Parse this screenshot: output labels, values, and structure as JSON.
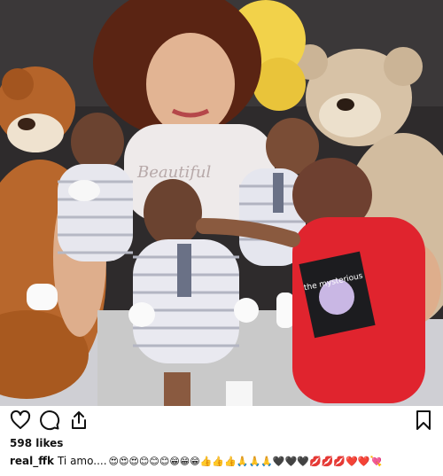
{
  "post": {
    "likes_text": "598 likes",
    "caption": {
      "username": "real_ffk",
      "text": "Ti amo....",
      "emojis": "😍😍😍😊😊😊😁😁😁👍👍👍🙏🙏🙏🖤🖤🖤💋💋💋❤️❤️💘"
    }
  },
  "icons": {
    "like": "heart-icon",
    "comment": "comment-icon",
    "share": "share-icon",
    "save": "bookmark-icon"
  },
  "colors": {
    "text": "#111111",
    "icon": "#111111",
    "background": "#ffffff"
  }
}
